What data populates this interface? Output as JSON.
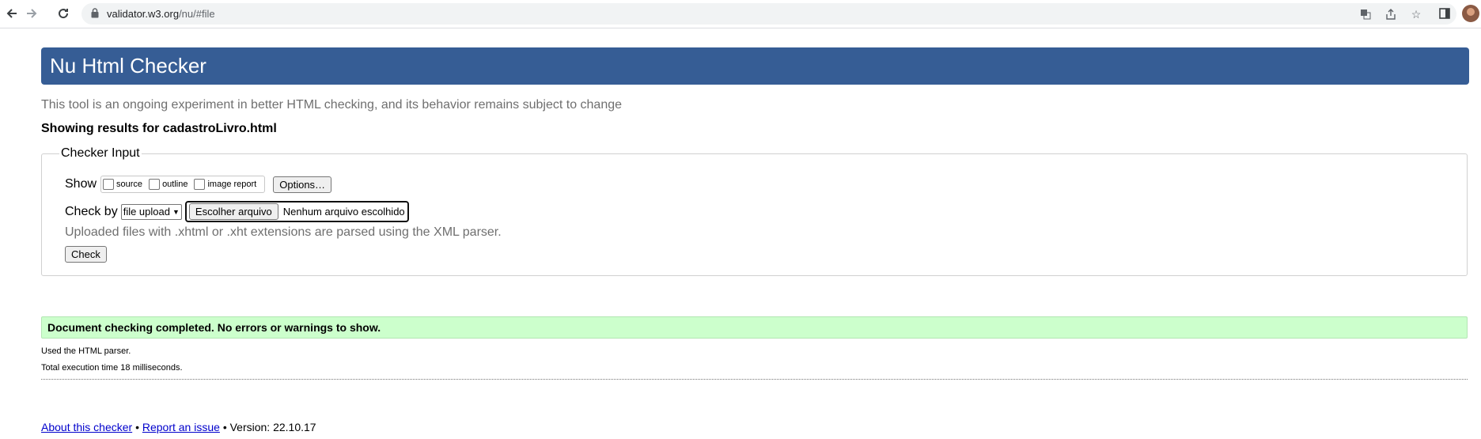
{
  "browser": {
    "url_host": "validator.w3.org",
    "url_path": "/nu/#file"
  },
  "page": {
    "title": "Nu Html Checker",
    "subtitle": "This tool is an ongoing experiment in better HTML checking, and its behavior remains subject to change",
    "showing": "Showing results for cadastroLivro.html"
  },
  "checker": {
    "legend": "Checker Input",
    "show_label": "Show",
    "checkboxes": [
      {
        "label": "source",
        "checked": false
      },
      {
        "label": "outline",
        "checked": false
      },
      {
        "label": "image report",
        "checked": false
      }
    ],
    "options_button": "Options…",
    "check_by_label": "Check by",
    "check_by_value": "file upload",
    "choose_file_button": "Escolher arquivo",
    "no_file_label": "Nenhum arquivo escolhido",
    "hint": "Uploaded files with .xhtml or .xht extensions are parsed using the XML parser.",
    "check_button": "Check"
  },
  "results": {
    "success": "Document checking completed. No errors or warnings to show.",
    "parser_info": "Used the HTML parser.",
    "time_info": "Total execution time 18 milliseconds."
  },
  "footer": {
    "about_link": "About this checker",
    "separator": "•",
    "report_link": "Report an issue",
    "version": "Version: 22.10.17"
  },
  "colors": {
    "banner": "#365d95",
    "success_bg": "#ccffcc"
  }
}
